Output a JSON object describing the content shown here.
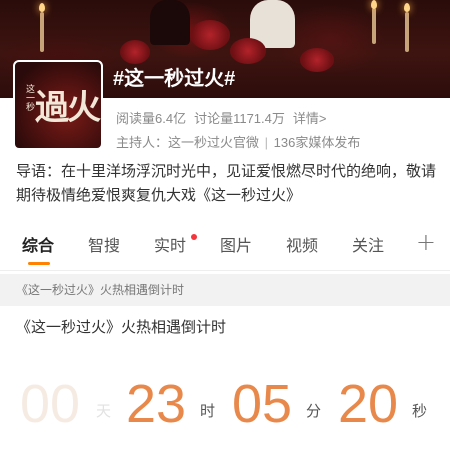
{
  "topic": {
    "title": "#这一秒过火#",
    "cover_big_text": "過火",
    "cover_side_text": "这一秒"
  },
  "stats": {
    "reads": "阅读量6.4亿",
    "discussions": "讨论量1171.4万",
    "details_link": "详情>"
  },
  "host": {
    "label": "主持人：",
    "name": "这一秒过火官微",
    "separator": "|",
    "media": "136家媒体发布"
  },
  "intro": "导语：在十里洋场浮沉时光中，见证爱恨燃尽时代的绝响，敬请期待极情绝爱恨爽复仇大戏《这一秒过火》",
  "tabs": [
    {
      "label": "综合",
      "active": true
    },
    {
      "label": "智搜",
      "active": false
    },
    {
      "label": "实时",
      "active": false,
      "has_dot": true
    },
    {
      "label": "图片",
      "active": false
    },
    {
      "label": "视频",
      "active": false
    },
    {
      "label": "关注",
      "active": false
    }
  ],
  "tab_more": "+",
  "section_header": "《这一秒过火》火热相遇倒计时",
  "card_title": "《这一秒过火》火热相遇倒计时",
  "countdown": {
    "days": "00",
    "days_unit": "天",
    "hours": "23",
    "hours_unit": "时",
    "minutes": "05",
    "minutes_unit": "分",
    "seconds": "20",
    "seconds_unit": "秒"
  },
  "colors": {
    "accent": "#ff8200",
    "countdown_number": "#e8894b",
    "notification_dot": "#f5343b"
  }
}
